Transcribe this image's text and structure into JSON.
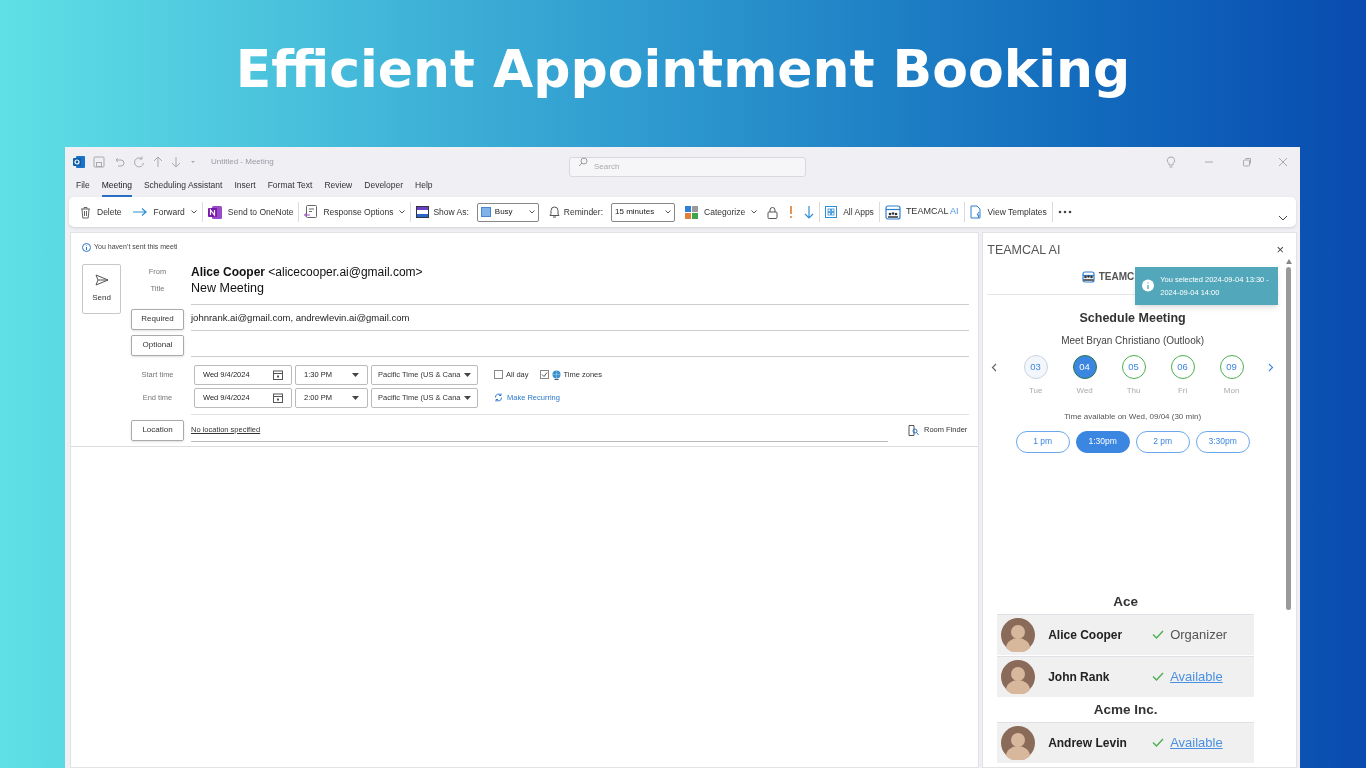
{
  "heading": "Efficient Appointment Booking",
  "window": {
    "title": "Untitled - Meeting",
    "search_placeholder": "Search"
  },
  "menu_tabs": [
    {
      "label": "File",
      "selected": false
    },
    {
      "label": "Meeting",
      "selected": true
    },
    {
      "label": "Scheduling Assistant",
      "selected": false
    },
    {
      "label": "Insert",
      "selected": false
    },
    {
      "label": "Format Text",
      "selected": false
    },
    {
      "label": "Review",
      "selected": false
    },
    {
      "label": "Developer",
      "selected": false
    },
    {
      "label": "Help",
      "selected": false
    }
  ],
  "ribbon_groups": [
    {
      "items": [
        {
          "kind": "button",
          "label": "Delete"
        },
        {
          "kind": "menu",
          "label": "Forward"
        }
      ]
    },
    {
      "items": [
        {
          "kind": "button",
          "label": "Send to OneNote"
        }
      ]
    },
    {
      "items": [
        {
          "kind": "menu",
          "label": "Response Options"
        }
      ]
    },
    {
      "items": [
        {
          "kind": "select",
          "label": "Show As:",
          "value": "Busy"
        },
        {
          "kind": "select",
          "label": "Reminder:",
          "value": "15 minutes"
        },
        {
          "kind": "menu",
          "label": "Categorize"
        },
        {
          "kind": "icon"
        },
        {
          "kind": "icon"
        },
        {
          "kind": "icon"
        }
      ]
    },
    {
      "items": [
        {
          "kind": "button",
          "label": "All Apps"
        }
      ]
    },
    {
      "items": [
        {
          "kind": "brand",
          "label": "TEAMCAL",
          "accent": "AI"
        }
      ]
    },
    {
      "items": [
        {
          "kind": "button",
          "label": "View Templates"
        }
      ]
    },
    {
      "items": [
        {
          "kind": "icon"
        }
      ]
    }
  ],
  "form": {
    "notice": "You haven’t sent this meeti",
    "send": "Send",
    "from": {
      "label": "From",
      "name": "Alice Cooper",
      "address": "<alicecooper.ai@gmail.com>"
    },
    "title": {
      "label": "Title",
      "value": "New Meeting"
    },
    "required": {
      "button": "Required",
      "value": "johnrank.ai@gmail.com, andrewlevin.ai@gmail.com"
    },
    "optional": {
      "button": "Optional"
    },
    "start": {
      "label": "Start time",
      "date": "Wed 9/4/2024",
      "time": "1:30 PM",
      "zone": "Pacific Time (US & Cana"
    },
    "end": {
      "label": "End time",
      "date": "Wed 9/4/2024",
      "time": "2:00 PM",
      "zone": "Pacific Time (US & Cana"
    },
    "all_day": {
      "label": "All day",
      "checked": false
    },
    "time_zones": {
      "label": "Time zones",
      "checked": true
    },
    "make_recurring": "Make Recurring",
    "location": {
      "button": "Location",
      "value": "No location specified"
    },
    "room_finder": "Room Finder"
  },
  "panel": {
    "title": "TEAMCAL AI",
    "close": "×",
    "brand": "TEAMC",
    "toast": "You selected 2024-09-04 13:30 - 2024-09-04 14:00",
    "heading": "Schedule Meeting",
    "subtitle": "Meet Bryan Christiano (Outlook)",
    "days": [
      {
        "day": "03",
        "weekday": "Tue",
        "selected": false,
        "available": false
      },
      {
        "day": "04",
        "weekday": "Wed",
        "selected": true,
        "available": true
      },
      {
        "day": "05",
        "weekday": "Thu",
        "selected": false,
        "available": true
      },
      {
        "day": "06",
        "weekday": "Fri",
        "selected": false,
        "available": true
      },
      {
        "day": "09",
        "weekday": "Mon",
        "selected": false,
        "available": true
      }
    ],
    "availability": "Time available on Wed, 09/04 (30 min)",
    "slots": [
      {
        "label": "1 pm",
        "selected": false
      },
      {
        "label": "1:30pm",
        "selected": true
      },
      {
        "label": "2 pm",
        "selected": false
      },
      {
        "label": "3:30pm",
        "selected": false
      }
    ],
    "groups": [
      {
        "name": "Ace",
        "members": [
          {
            "name": "Alice Cooper",
            "kind": "organizer",
            "status": "Organizer"
          },
          {
            "name": "John Rank",
            "kind": "available",
            "status": "Available"
          }
        ]
      },
      {
        "name": "Acme Inc.",
        "members": [
          {
            "name": "Andrew Levin",
            "kind": "available",
            "status": "Available"
          }
        ]
      }
    ]
  }
}
